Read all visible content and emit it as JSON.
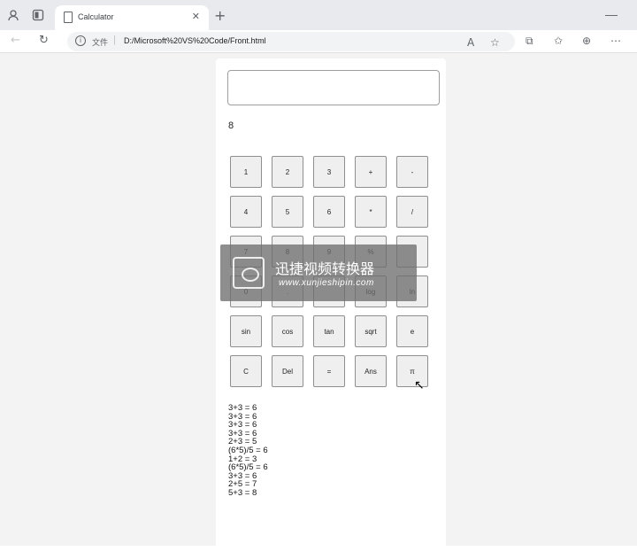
{
  "browser": {
    "tab_title": "Calculator",
    "url_scheme": "文件",
    "url": "D:/Microsoft%20VS%20Code/Front.html"
  },
  "calculator": {
    "display_value": "",
    "result": "8",
    "buttons": [
      "1",
      "2",
      "3",
      "+",
      "-",
      "4",
      "5",
      "6",
      "*",
      "/",
      "7",
      "8",
      "9",
      "%",
      "",
      "0",
      ".",
      "",
      "log",
      "ln",
      "sin",
      "cos",
      "tan",
      "sqrt",
      "e",
      "C",
      "Del",
      "=",
      "Ans",
      "π"
    ],
    "history": [
      "3+3 = 6",
      "3+3 = 6",
      "3+3 = 6",
      "3+3 = 6",
      "2+3 = 5",
      "(6*5)/5 = 6",
      "1+2 = 3",
      "(6*5)/5 = 6",
      "3+3 = 6",
      "2+5 = 7",
      "5+3 = 8"
    ]
  },
  "watermark": {
    "title": "迅捷视频转换器",
    "url": "www.xunjieshipin.com"
  },
  "icons": {
    "profile": "profile-icon",
    "tabs": "tab-actions-icon",
    "back": "back-arrow-icon",
    "reload": "reload-icon",
    "info": "info-icon",
    "read_aloud": "read-aloud-icon",
    "favorite": "star-icon",
    "split": "split-screen-icon",
    "favorites": "favorites-icon",
    "collections": "collections-icon",
    "more": "more-icon"
  }
}
